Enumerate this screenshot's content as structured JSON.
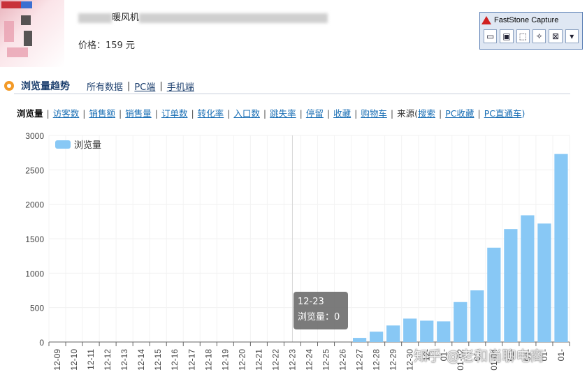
{
  "header": {
    "title_visible": "暖风机",
    "price": "价格：159 元"
  },
  "fastStone": {
    "title": "FastStone Capture"
  },
  "section": {
    "title": "浏览量趋势",
    "links": [
      "所有数据",
      "PC端",
      "手机端"
    ]
  },
  "metrics": {
    "active": "浏览量",
    "items": [
      "访客数",
      "销售额",
      "销售量",
      "订单数",
      "转化率",
      "入口数",
      "跳失率",
      "停留",
      "收藏",
      "购物车"
    ],
    "source_label": "来源(",
    "source_items": [
      "搜索",
      "PC收藏",
      "PC直通车"
    ],
    "source_end": ")"
  },
  "tooltip": {
    "date": "12-23",
    "label": "浏览量：0"
  },
  "watermark": "知乎 @老和尚聊电商",
  "colors": {
    "bar": "#88c8f5",
    "accent": "#f39a27",
    "link": "#1a6fb5"
  },
  "chart_data": {
    "type": "bar",
    "legend": "浏览量",
    "legend_position": "top-left",
    "ylim": [
      0,
      3000
    ],
    "yticks": [
      0,
      500,
      1000,
      1500,
      2000,
      2500,
      3000
    ],
    "categories": [
      "12-09",
      "12-10",
      "12-11",
      "12-12",
      "12-13",
      "12-14",
      "12-15",
      "12-16",
      "12-17",
      "12-18",
      "12-19",
      "12-20",
      "12-21",
      "12-22",
      "12-23",
      "12-24",
      "12-25",
      "12-26",
      "12-27",
      "12-28",
      "12-29",
      "12-30",
      "12-31",
      "01-01",
      "01-02",
      "01-03",
      "01-04",
      "01-05",
      "01-06",
      "01-07",
      "01-08"
    ],
    "category_labels": [
      "12-09",
      "12-10",
      "12-11",
      "12-12",
      "12-13",
      "12-14",
      "12-15",
      "12-16",
      "12-17",
      "12-18",
      "12-19",
      "12-20",
      "12-21",
      "12-22",
      "12-23",
      "12-24",
      "12-25",
      "12-26",
      "12-27",
      "12-28",
      "12-29",
      "12-30",
      "12-",
      "01-",
      "01-02",
      "01-",
      "01-04",
      "01-",
      "01-",
      "01-",
      "01-"
    ],
    "values": [
      0,
      0,
      0,
      0,
      0,
      0,
      0,
      0,
      0,
      0,
      0,
      0,
      0,
      0,
      0,
      0,
      0,
      0,
      60,
      150,
      240,
      340,
      310,
      300,
      580,
      750,
      1370,
      1640,
      1840,
      1720,
      2730
    ],
    "highlight_category": "12-23",
    "grid": true
  }
}
